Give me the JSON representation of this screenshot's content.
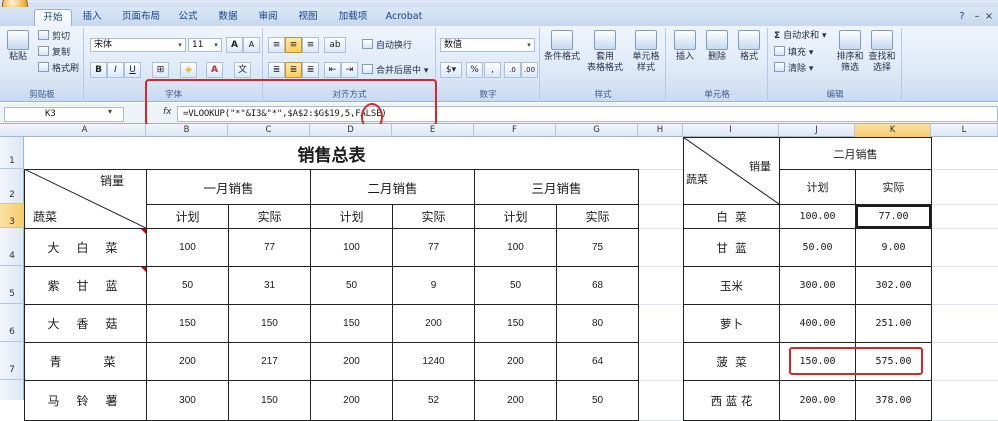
{
  "ribbon": {
    "tabs": [
      "开始",
      "插入",
      "页面布局",
      "公式",
      "数据",
      "审阅",
      "视图",
      "加载项",
      "Acrobat"
    ],
    "clipboard": {
      "paste": "粘贴",
      "cut": "剪切",
      "copy": "复制",
      "format_painter": "格式刷",
      "label": "剪贴板"
    },
    "font": {
      "name": "宋体",
      "size": "11",
      "grow": "A",
      "shrink": "A",
      "bold": "B",
      "italic": "I",
      "underline": "U",
      "label": "字体"
    },
    "alignment": {
      "wrap": "自动换行",
      "merge": "合并后居中",
      "label": "对齐方式"
    },
    "number": {
      "format": "数值",
      "percent": "%",
      "comma": ",",
      "label": "数字"
    },
    "styles": {
      "conditional": "条件格式",
      "table_format_1": "套用",
      "table_format_2": "表格格式",
      "cell_style_1": "单元格",
      "cell_style_2": "样式",
      "label": "样式"
    },
    "cells": {
      "insert": "插入",
      "delete": "删除",
      "format": "格式",
      "label": "单元格"
    },
    "editing": {
      "autosum": "自动求和",
      "fill": "填充",
      "clear": "清除",
      "sort_1": "排序和",
      "sort_2": "筛选",
      "find_1": "查找和",
      "find_2": "选择",
      "label": "编辑"
    }
  },
  "formula_bar": {
    "name_box": "K3",
    "fx": "fx",
    "formula": "=VLOOKUP(\"*\"&I3&\"*\",$A$2:$G$19,5,FALSE)"
  },
  "columns": [
    "A",
    "B",
    "C",
    "D",
    "E",
    "F",
    "G",
    "H",
    "I",
    "J",
    "K",
    "L"
  ],
  "rows": [
    "1",
    "2",
    "3",
    "4",
    "5",
    "6",
    "7"
  ],
  "left_table": {
    "title": "销售总表",
    "corner_top": "销量",
    "corner_bottom": "蔬菜",
    "months": [
      "一月销售",
      "二月销售",
      "三月销售"
    ],
    "sub": [
      "计划",
      "实际",
      "计划",
      "实际",
      "计划",
      "实际"
    ],
    "rows": [
      {
        "name": [
          "大",
          "白",
          "菜"
        ],
        "values": [
          "100",
          "77",
          "100",
          "77",
          "100",
          "75"
        ]
      },
      {
        "name": [
          "紫",
          "甘",
          "蓝"
        ],
        "values": [
          "50",
          "31",
          "50",
          "9",
          "50",
          "68"
        ]
      },
      {
        "name": [
          "大",
          "香",
          "菇"
        ],
        "values": [
          "150",
          "150",
          "150",
          "200",
          "150",
          "80"
        ]
      },
      {
        "name": [
          "青",
          "",
          "菜"
        ],
        "values": [
          "200",
          "217",
          "200",
          "1240",
          "200",
          "64"
        ]
      },
      {
        "name": [
          "马",
          "铃",
          "薯"
        ],
        "values": [
          "300",
          "150",
          "200",
          "52",
          "200",
          "50"
        ]
      }
    ]
  },
  "right_table": {
    "corner_top": "销量",
    "corner_bottom": "蔬菜",
    "month": "二月销售",
    "sub": [
      "计划",
      "实际"
    ],
    "rows": [
      {
        "name": "白  菜",
        "plan": "100.00",
        "actual": "77.00"
      },
      {
        "name": "甘  蓝",
        "plan": "50.00",
        "actual": "9.00"
      },
      {
        "name": "玉米",
        "plan": "300.00",
        "actual": "302.00"
      },
      {
        "name": "萝卜",
        "plan": "400.00",
        "actual": "251.00"
      },
      {
        "name": "菠  菜",
        "plan": "150.00",
        "actual": "575.00"
      },
      {
        "name": "西 蓝 花",
        "plan": "200.00",
        "actual": "378.00"
      }
    ]
  },
  "colors": {
    "highlight": "#d9262a",
    "ribbon": "#dbe7f6"
  }
}
